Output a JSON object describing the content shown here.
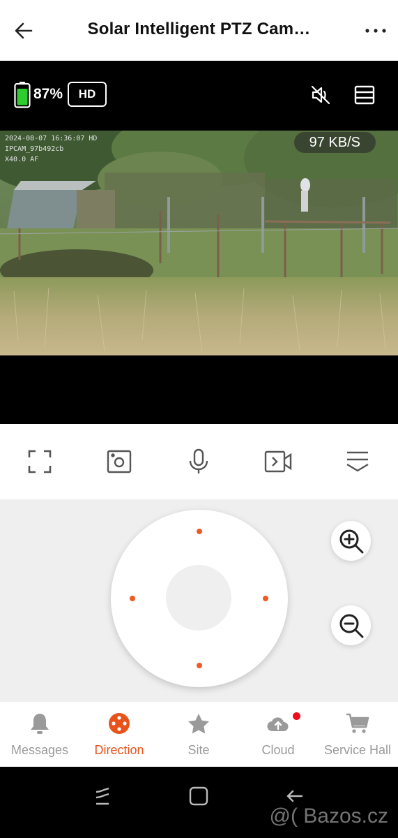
{
  "header": {
    "title": "Solar Intelligent PTZ Cam…",
    "back_icon": "arrow-left-icon",
    "more_icon": "more-horizontal-icon"
  },
  "status": {
    "battery_percent": "87%",
    "battery_level": 0.87,
    "battery_color": "#2ecc2e",
    "quality_badge": "HD",
    "mute_icon": "speaker-muted-icon",
    "layout_icon": "layout-list-icon"
  },
  "video": {
    "osd_datetime": "2024-08-07 16:36:07 HD",
    "osd_camera": "IPCAM_97b492cb",
    "osd_zoom": "X40.0 AF",
    "bitrate": "97 KB/S"
  },
  "toolbar": {
    "items": [
      {
        "name": "fullscreen-icon"
      },
      {
        "name": "snapshot-icon"
      },
      {
        "name": "microphone-icon"
      },
      {
        "name": "record-video-icon"
      },
      {
        "name": "collapse-menu-icon"
      }
    ]
  },
  "ptz": {
    "accent": "#ee5a24",
    "zoom_in_icon": "zoom-in-icon",
    "zoom_out_icon": "zoom-out-icon"
  },
  "bottom_nav": {
    "items": [
      {
        "label": "Messages",
        "icon": "bell-icon"
      },
      {
        "label": "Direction",
        "icon": "direction-pad-icon",
        "active": true
      },
      {
        "label": "Site",
        "icon": "star-icon"
      },
      {
        "label": "Cloud",
        "icon": "cloud-upload-icon",
        "badge": true
      },
      {
        "label": "Service Hall",
        "icon": "shopping-cart-icon"
      }
    ],
    "active_color": "#e8531b",
    "inactive_color": "#9a9a9a"
  },
  "system_nav": {
    "recent_icon": "recent-apps-icon",
    "home_icon": "home-icon",
    "back_icon": "back-icon"
  },
  "watermark": "@( Bazos.cz"
}
